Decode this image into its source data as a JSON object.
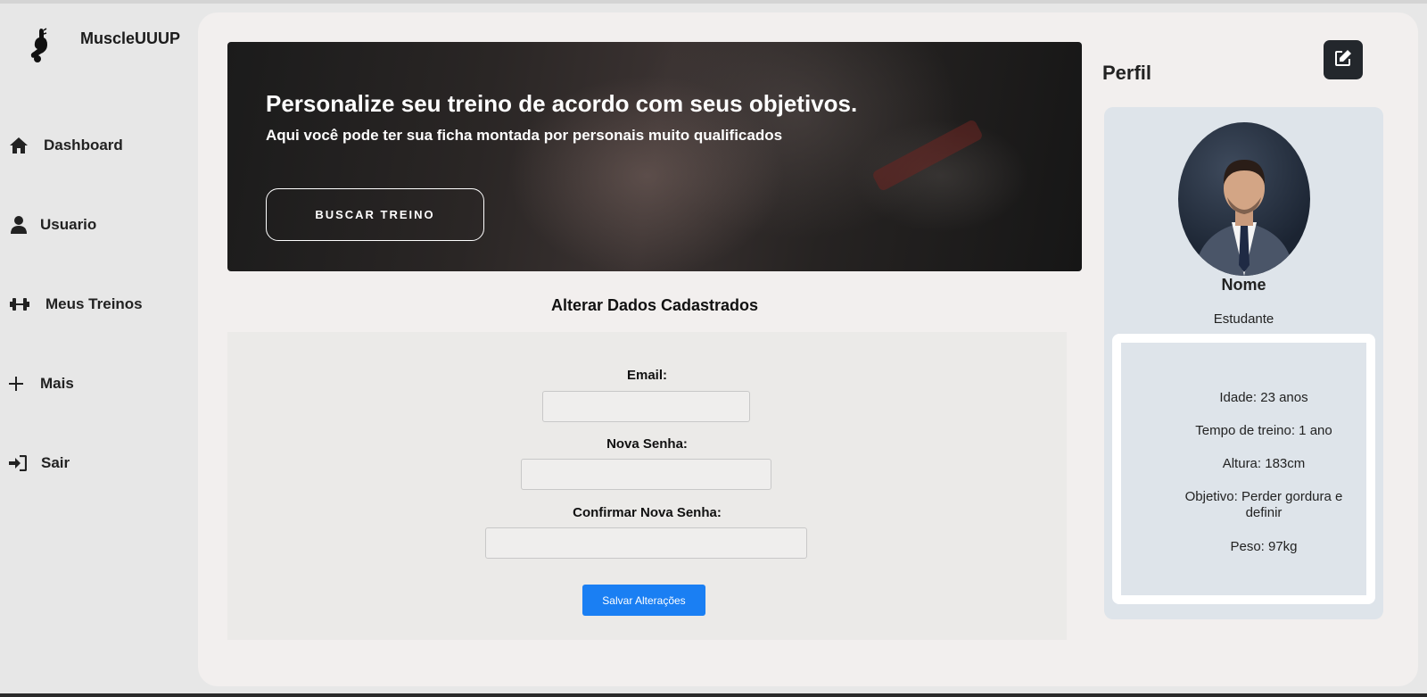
{
  "app": {
    "brand": "MuscleUUUP"
  },
  "sidebar": {
    "items": [
      {
        "label": "Dashboard",
        "icon": "home-icon"
      },
      {
        "label": "Usuario",
        "icon": "user-icon"
      },
      {
        "label": "Meus Treinos",
        "icon": "dumbbell-icon"
      },
      {
        "label": "Mais",
        "icon": "plus-icon"
      },
      {
        "label": "Sair",
        "icon": "sign-in-icon"
      }
    ]
  },
  "hero": {
    "title": "Personalize seu treino de acordo com seus objetivos.",
    "subtitle": "Aqui você pode ter sua ficha montada por personais muito qualificados",
    "button_label": "BUSCAR TREINO"
  },
  "form": {
    "title": "Alterar Dados Cadastrados",
    "email_label": "Email:",
    "email_value": "",
    "password_label": "Nova Senha:",
    "password_value": "",
    "confirm_label": "Confirmar Nova Senha:",
    "confirm_value": "",
    "save_label": "Salvar Alterações"
  },
  "profile": {
    "title": "Perfil",
    "edit_icon": "edit-icon",
    "name": "Nome",
    "role": "Estudante",
    "info": [
      "Idade: 23 anos",
      "Tempo de treino: 1 ano",
      "Altura: 183cm",
      "Objetivo: Perder gordura e definir",
      "Peso: 97kg"
    ]
  },
  "colors": {
    "accent": "#1a7ff3",
    "panel": "#f2efee",
    "sidebar": "#e7e7e7",
    "card": "#dee4ea",
    "dark_button": "#23272c"
  }
}
